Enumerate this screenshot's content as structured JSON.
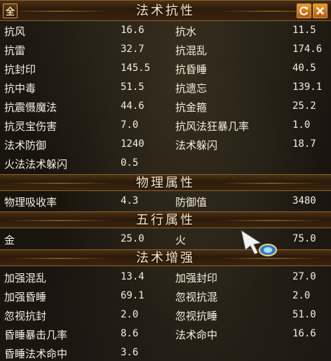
{
  "buttons": {
    "all_label": "全",
    "refresh_icon": "refresh-icon",
    "close_icon": "close-icon"
  },
  "sections": [
    {
      "title": "法术抗性",
      "rows": [
        [
          "抗风",
          "16.6",
          "抗水",
          "11.5"
        ],
        [
          "抗雷",
          "32.7",
          "抗混乱",
          "174.6"
        ],
        [
          "抗封印",
          "145.5",
          "抗昏睡",
          "40.5"
        ],
        [
          "抗中毒",
          "51.5",
          "抗遗忘",
          "139.1"
        ],
        [
          "抗震慑魔法",
          "44.6",
          "抗金箍",
          "25.2"
        ],
        [
          "抗灵宝伤害",
          "7.0",
          "抗风法狂暴几率",
          "1.0"
        ],
        [
          "法术防御",
          "1240",
          "法术躲闪",
          "18.7"
        ],
        [
          "火法法术躲闪",
          "0.5",
          "",
          ""
        ]
      ]
    },
    {
      "title": "物理属性",
      "rows": [
        [
          "物理吸收率",
          "4.3",
          "防御值",
          "3480"
        ]
      ]
    },
    {
      "title": "五行属性",
      "rows": [
        [
          "金",
          "25.0",
          "火",
          "75.0"
        ]
      ]
    },
    {
      "title": "法术增强",
      "rows": [
        [
          "加强混乱",
          "13.4",
          "加强封印",
          "27.0"
        ],
        [
          "加强昏睡",
          "69.1",
          "忽视抗混",
          "2.0"
        ],
        [
          "忽视抗封",
          "2.0",
          "忽视抗睡",
          "51.0"
        ],
        [
          "昏睡暴击几率",
          "8.6",
          "法术命中",
          "16.6"
        ],
        [
          "昏睡法术命中",
          "3.6",
          "",
          ""
        ]
      ]
    }
  ]
}
